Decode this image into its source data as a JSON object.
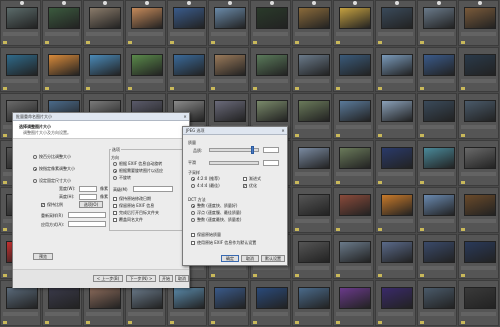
{
  "thumbnail_colors": [
    [
      "#5b6b6a",
      "#3b5a3e",
      "#8a7b6a",
      "#c58a5a",
      "#3a5b8b",
      "#6a8aa8",
      "#2a3a2a",
      "#8a6a3a",
      "#c4a040",
      "#3a4a5a",
      "#6a7a8a",
      "#7a5a3a"
    ],
    [
      "#2f6a8a",
      "#d88a3a",
      "#4a8ab8",
      "#5a8a4a",
      "#3a6a9a",
      "#9a7a5a",
      "#5a7a5a",
      "#6a7a8a",
      "#3a5a7a",
      "#7a9aba",
      "#3a5a8a",
      "#2a3a4a"
    ],
    [
      "#6a6a6a",
      "#4a6a8a",
      "#7a7a7a",
      "#5a5a6a",
      "#8a8a8a",
      "#6a6a7a",
      "#7a8a6a",
      "#6a7a5a",
      "#5a7a9a",
      "#8aa0b8",
      "#3a4a5a",
      "#4a5a6a"
    ],
    [
      "#555",
      "#555",
      "#555",
      "#555",
      "#555",
      "#555",
      "#555",
      "#7a8aa0",
      "#6a7a5a",
      "#2a3a6a",
      "#4a8a9a",
      "#6a6a6a"
    ],
    [
      "#555",
      "#555",
      "#555",
      "#555",
      "#555",
      "#555",
      "#555",
      "#555",
      "#8a4a3a",
      "#c87a2a",
      "#6a8ab0",
      "#6a4a2a"
    ],
    [
      "#c43030",
      "#555",
      "#555",
      "#555",
      "#555",
      "#555",
      "#555",
      "#555",
      "#6a7a8a",
      "#5a6a8a",
      "#3a4a6a",
      "#2a3a5a"
    ],
    [
      "#5a6a7a",
      "#3a3a4a",
      "#8a6a5a",
      "#6a7a8a",
      "#5a8aaa",
      "#3a5a8a",
      "#2a4a7a",
      "#4a6a8a",
      "#6a3a8a",
      "#3a2a6a",
      "#4a5a6a",
      "#3a3a3a"
    ]
  ],
  "main_dialog": {
    "title": "批量重命名图片大小",
    "heading": "选择调整图片大小",
    "subheading": "调整图片大小及方向设置。",
    "option_by_percent": "按百分比调整大小",
    "option_by_pixels": "按指定像素调整大小",
    "option_fixed_size": "设定固定尺寸大小",
    "width_label": "宽度(W):",
    "height_label": "高度(H):",
    "width_value": "",
    "height_value": "",
    "unit": "像素",
    "keep_ratio_label": "保持比例",
    "resample_label": "重新采样(R)",
    "resample_value": "",
    "apply_label": "应用方式(A):",
    "apply_value": "",
    "right_group_title": "选项",
    "rotate_label": "方向",
    "rotate_opt1": "根据 EXIF 信息自动旋转",
    "rotate_opt2": "根据需要旋转图片以适应",
    "rotate_opt3": "不旋转",
    "advanced_label": "高级(M)",
    "advanced_value": "",
    "check1": "保持原始修改日期",
    "check2": "保留原始 EXIF 信息",
    "check3": "完成后打开目标文件夹",
    "check4": "覆盖同名文件",
    "btn_options": "选项(O)",
    "btn_preview": "预览",
    "btn_back": "< 上一步(B)",
    "btn_next": "下一步(N) >",
    "btn_start": "开始",
    "btn_cancel": "取消"
  },
  "sub_dialog": {
    "title": "JPEG 选项",
    "quality_label": "质量",
    "quality_value": "",
    "quality_note": "品质:",
    "smoothing_label": "平滑",
    "smoothing_value": "",
    "sampling_label": "子采样",
    "sampling_opt1": "4:2:0 (推荐)",
    "sampling_opt2": "4:4:4 (最佳)",
    "chk_progressive": "渐进式",
    "chk_optimize": "优化",
    "method_label": "DCT 方法",
    "method_opt1": "整数 (速度快、质量好)",
    "method_opt2": "浮点 (速度慢、最佳质量)",
    "method_opt3": "整数 (速度最快、质量差)",
    "chk_keep": "保留原始质量",
    "chk_exif": "使用原始 EXIF 信息作为默认设置",
    "btn_ok": "确定",
    "btn_cancel": "取消",
    "btn_default": "默认设置"
  }
}
